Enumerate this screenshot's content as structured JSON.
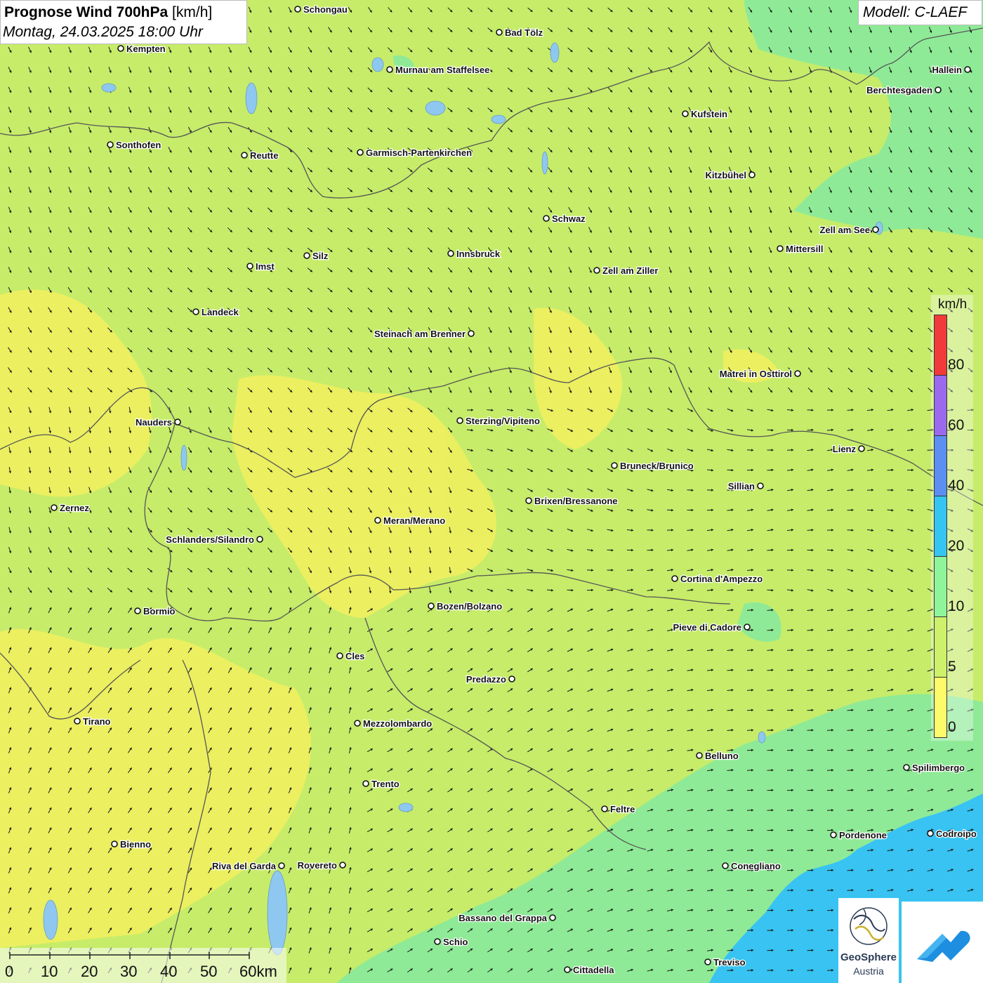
{
  "header": {
    "title_bold": "Prognose Wind 700hPa",
    "title_unit": "[km/h]",
    "datetime": "Montag, 24.03.2025 18:00 Uhr",
    "model": "Modell: C-LAEF"
  },
  "legend": {
    "unit": "km/h",
    "ticks": [
      "0",
      "5",
      "10",
      "20",
      "40",
      "60",
      "80"
    ],
    "colors": [
      "#fdfb6a",
      "#cdf16a",
      "#8ff59a",
      "#34c5f2",
      "#5b8ff2",
      "#9a69ee",
      "#f23a3a"
    ]
  },
  "colors": {
    "calm": "#f1f05e",
    "light": "#c6ec6a",
    "moderate": "#8eea96",
    "fresh": "#38c3f2",
    "arrow": "#1a1a1a",
    "border": "#555555"
  },
  "scalebar": {
    "labels": [
      "0",
      "10",
      "20",
      "30",
      "40",
      "50",
      "60km"
    ]
  },
  "cities": [
    {
      "name": "Schongau"
    },
    {
      "name": "Bad Tölz"
    },
    {
      "name": "Kempten"
    },
    {
      "name": "Murnau am Staffelsee"
    },
    {
      "name": "Hallein"
    },
    {
      "name": "Berchtesgaden"
    },
    {
      "name": "Kufstein"
    },
    {
      "name": "Sonthofen"
    },
    {
      "name": "Reutte"
    },
    {
      "name": "Garmisch-Partenkirchen"
    },
    {
      "name": "Kitzbühel"
    },
    {
      "name": "Schwaz"
    },
    {
      "name": "Zell am See"
    },
    {
      "name": "Mittersill"
    },
    {
      "name": "Silz"
    },
    {
      "name": "Innsbruck"
    },
    {
      "name": "Imst"
    },
    {
      "name": "Zell am Ziller"
    },
    {
      "name": "Landeck"
    },
    {
      "name": "Steinach am Brenner"
    },
    {
      "name": "Matrei in Osttirol"
    },
    {
      "name": "Nauders"
    },
    {
      "name": "Sterzing/Vipiteno"
    },
    {
      "name": "Lienz"
    },
    {
      "name": "Bruneck/Brunico"
    },
    {
      "name": "Sillian"
    },
    {
      "name": "Brixen/Bressanone"
    },
    {
      "name": "Zernez"
    },
    {
      "name": "Meran/Merano"
    },
    {
      "name": "Schlanders/Silandro"
    },
    {
      "name": "Cortina d'Ampezzo"
    },
    {
      "name": "Bozen/Bolzano"
    },
    {
      "name": "Bormio"
    },
    {
      "name": "Pieve di Cadore"
    },
    {
      "name": "Cles"
    },
    {
      "name": "Predazzo"
    },
    {
      "name": "Tirano"
    },
    {
      "name": "Mezzolombardo"
    },
    {
      "name": "Belluno"
    },
    {
      "name": "Spilimbergo"
    },
    {
      "name": "Trento"
    },
    {
      "name": "Feltre"
    },
    {
      "name": "Pordenone"
    },
    {
      "name": "Codroipo"
    },
    {
      "name": "Bienno"
    },
    {
      "name": "Riva del Garda"
    },
    {
      "name": "Rovereto"
    },
    {
      "name": "Conegliano"
    },
    {
      "name": "Bassano del Grappa"
    },
    {
      "name": "Schio"
    },
    {
      "name": "Treviso"
    },
    {
      "name": "Cittadella"
    }
  ],
  "logo": {
    "line1": "GeoSphere",
    "line2": "Austria"
  }
}
